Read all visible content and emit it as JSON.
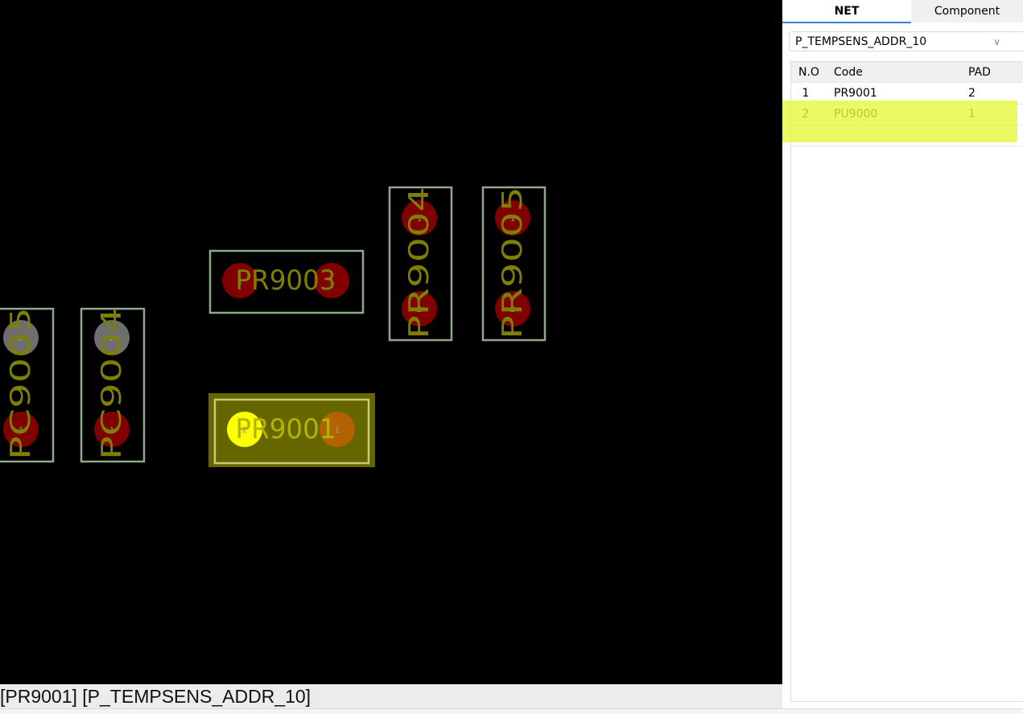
{
  "canvas": {
    "colors": {
      "background": "#000000",
      "outline": "#8fa88a",
      "pad": "#800000",
      "pad_inactive": "#6e6e6e",
      "label": "#808000",
      "highlight_fill": "#666600",
      "highlight_outline": "#c8c878",
      "selected_pad": "#ffff00",
      "selected_pad2": "#b36200"
    },
    "components": [
      {
        "ref": "PC9005",
        "pads": [
          "2",
          "1"
        ]
      },
      {
        "ref": "PC9004",
        "pads": [
          "2",
          "1"
        ]
      },
      {
        "ref": "PR9003",
        "pads": [
          "2",
          "1"
        ]
      },
      {
        "ref": "PR9004",
        "pads": [
          "1",
          "2"
        ]
      },
      {
        "ref": "PR9005",
        "pads": [
          "1",
          "2"
        ]
      },
      {
        "ref": "PR9001",
        "pads": [
          "2",
          "1"
        ]
      }
    ]
  },
  "status": {
    "text": "[PR9001] [P_TEMPSENS_ADDR_10]"
  },
  "panel": {
    "tabs": [
      {
        "label": "NET"
      },
      {
        "label": "Component"
      }
    ],
    "net_select": {
      "value": "P_TEMPSENS_ADDR_10",
      "icon": "chevron-down-icon"
    },
    "table": {
      "headers": [
        "N.O",
        "Code",
        "PAD"
      ],
      "rows": [
        {
          "no": "1",
          "code": "PR9001",
          "pad": "2"
        },
        {
          "no": "2",
          "code": "PU9000",
          "pad": "1"
        }
      ]
    },
    "highlight_color": "#e6f83c"
  }
}
